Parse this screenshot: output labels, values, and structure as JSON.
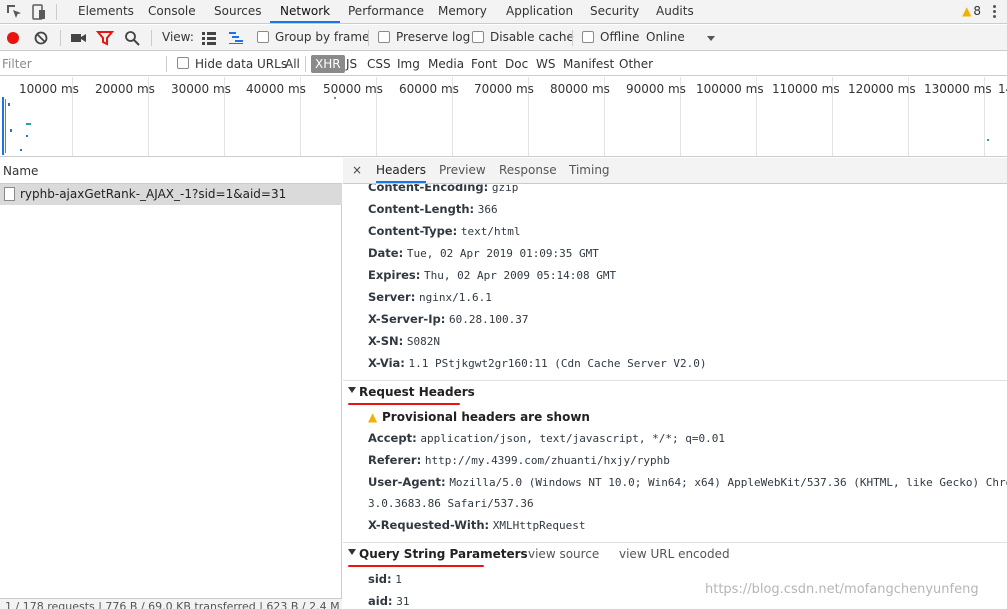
{
  "tabbar": {
    "tabs": [
      "Elements",
      "Console",
      "Sources",
      "Network",
      "Performance",
      "Memory",
      "Application",
      "Security",
      "Audits"
    ],
    "active_tab": "Network",
    "warning_count": "8"
  },
  "toolbar": {
    "view_label": "View:",
    "group_by_frame": "Group by frame",
    "preserve_log": "Preserve log",
    "disable_cache": "Disable cache",
    "offline": "Offline",
    "throttling": "Online"
  },
  "filterbar": {
    "placeholder": "Filter",
    "hide_data_urls": "Hide data URLs",
    "types": [
      "All",
      "XHR",
      "JS",
      "CSS",
      "Img",
      "Media",
      "Font",
      "Doc",
      "WS",
      "Manifest",
      "Other"
    ],
    "active_type": "XHR"
  },
  "overview": {
    "ticks": [
      "10000 ms",
      "20000 ms",
      "30000 ms",
      "40000 ms",
      "50000 ms",
      "60000 ms",
      "70000 ms",
      "80000 ms",
      "90000 ms",
      "100000 ms",
      "110000 ms",
      "120000 ms",
      "130000 ms",
      "14"
    ]
  },
  "requests": {
    "column_name": "Name",
    "rows": [
      {
        "name": "ryphb-ajaxGetRank-_AJAX_-1?sid=1&aid=31"
      }
    ]
  },
  "status": "1 / 178 requests | 776 B / 69.0 KB transferred | 623 B / 2.4 M",
  "details": {
    "close_icon": "×",
    "tabs": [
      "Headers",
      "Preview",
      "Response",
      "Timing"
    ],
    "active_tab": "Headers",
    "response_headers": [
      {
        "key": "Content-Encoding:",
        "value": "gzip"
      },
      {
        "key": "Content-Length:",
        "value": "366"
      },
      {
        "key": "Content-Type:",
        "value": "text/html"
      },
      {
        "key": "Date:",
        "value": "Tue, 02 Apr 2019 01:09:35 GMT"
      },
      {
        "key": "Expires:",
        "value": "Thu, 02 Apr 2009 05:14:08 GMT"
      },
      {
        "key": "Server:",
        "value": "nginx/1.6.1"
      },
      {
        "key": "X-Server-Ip:",
        "value": "60.28.100.37"
      },
      {
        "key": "X-SN:",
        "value": "S082N"
      },
      {
        "key": "X-Via:",
        "value": "1.1 PStjkgwt2gr160:11 (Cdn Cache Server V2.0)"
      }
    ],
    "request_section": {
      "title": "Request Headers",
      "provisional": "Provisional headers are shown",
      "headers": [
        {
          "key": "Accept:",
          "value": "application/json, text/javascript, */*; q=0.01"
        },
        {
          "key": "Referer:",
          "value": "http://my.4399.com/zhuanti/hxjy/ryphb"
        },
        {
          "key": "User-Agent:",
          "value": "Mozilla/5.0 (Windows NT 10.0; Win64; x64) AppleWebKit/537.36 (KHTML, like Gecko) Chrom"
        },
        {
          "key": "",
          "value": "3.0.3683.86 Safari/537.36"
        },
        {
          "key": "X-Requested-With:",
          "value": "XMLHttpRequest"
        }
      ]
    },
    "query_section": {
      "title": "Query String Parameters",
      "view_source": "view source",
      "view_url_encoded": "view URL encoded",
      "params": [
        {
          "key": "sid:",
          "value": "1"
        },
        {
          "key": "aid:",
          "value": "31"
        }
      ]
    }
  },
  "watermark": "https://blog.csdn.net/mofangchenyunfeng",
  "colors": {
    "accent": "#1a73e8",
    "record": "#e8140f",
    "warning": "#f0b400",
    "annotation": "#e8140f"
  }
}
